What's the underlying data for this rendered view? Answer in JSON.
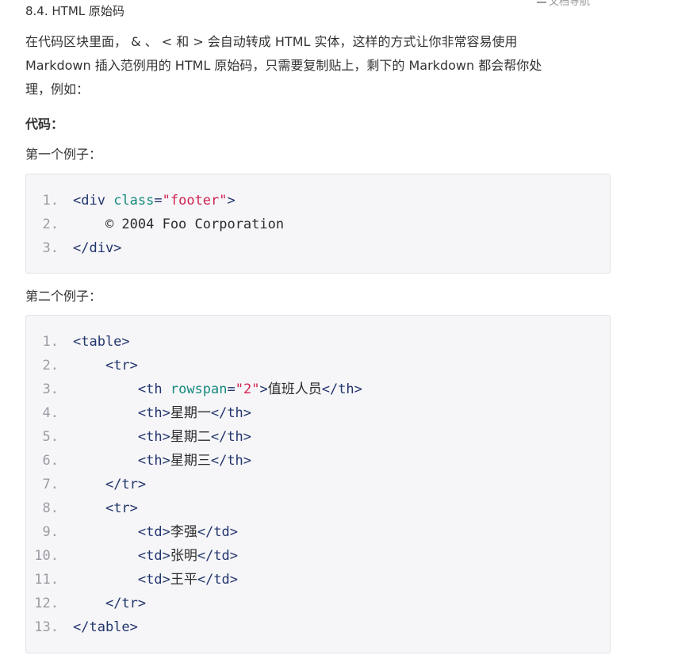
{
  "heading": "8.4. HTML 原始码",
  "corner_link": "文档导航",
  "intro_line1": "在代码区块里面， & 、 < 和 > 会自动转成 HTML 实体，这样的方式让你非常容易使用",
  "intro_line2": "Markdown 插入范例用的 HTML 原始码，只需要复制贴上，剩下的 Markdown 都会帮你处",
  "intro_line3": "理，例如：",
  "code_label": "代码：",
  "example1_label": "第一个例子：",
  "example2_label": "第二个例子：",
  "example1": {
    "line_numbers": [
      "1.",
      "2.",
      "3."
    ],
    "lines": [
      [
        {
          "t": "tag",
          "v": "<div "
        },
        {
          "t": "attr",
          "v": "class"
        },
        {
          "t": "punc",
          "v": "="
        },
        {
          "t": "str",
          "v": "\"footer\""
        },
        {
          "t": "tag",
          "v": ">"
        }
      ],
      [
        {
          "t": "txt",
          "v": "    © 2004 Foo Corporation"
        }
      ],
      [
        {
          "t": "tag",
          "v": "</div>"
        }
      ]
    ]
  },
  "example2": {
    "line_numbers": [
      "1.",
      "2.",
      "3.",
      "4.",
      "5.",
      "6.",
      "7.",
      "8.",
      "9.",
      "10.",
      "11.",
      "12.",
      "13."
    ],
    "lines": [
      [
        {
          "t": "tag",
          "v": "<table>"
        }
      ],
      [
        {
          "t": "txt",
          "v": "    "
        },
        {
          "t": "tag",
          "v": "<tr>"
        }
      ],
      [
        {
          "t": "txt",
          "v": "        "
        },
        {
          "t": "tag",
          "v": "<th "
        },
        {
          "t": "attr",
          "v": "rowspan"
        },
        {
          "t": "punc",
          "v": "="
        },
        {
          "t": "str",
          "v": "\"2\""
        },
        {
          "t": "tag",
          "v": ">"
        },
        {
          "t": "txt",
          "v": "值班人员"
        },
        {
          "t": "tag",
          "v": "</th>"
        }
      ],
      [
        {
          "t": "txt",
          "v": "        "
        },
        {
          "t": "tag",
          "v": "<th>"
        },
        {
          "t": "txt",
          "v": "星期一"
        },
        {
          "t": "tag",
          "v": "</th>"
        }
      ],
      [
        {
          "t": "txt",
          "v": "        "
        },
        {
          "t": "tag",
          "v": "<th>"
        },
        {
          "t": "txt",
          "v": "星期二"
        },
        {
          "t": "tag",
          "v": "</th>"
        }
      ],
      [
        {
          "t": "txt",
          "v": "        "
        },
        {
          "t": "tag",
          "v": "<th>"
        },
        {
          "t": "txt",
          "v": "星期三"
        },
        {
          "t": "tag",
          "v": "</th>"
        }
      ],
      [
        {
          "t": "txt",
          "v": "    "
        },
        {
          "t": "tag",
          "v": "</tr>"
        }
      ],
      [
        {
          "t": "txt",
          "v": "    "
        },
        {
          "t": "tag",
          "v": "<tr>"
        }
      ],
      [
        {
          "t": "txt",
          "v": "        "
        },
        {
          "t": "tag",
          "v": "<td>"
        },
        {
          "t": "txt",
          "v": "李强"
        },
        {
          "t": "tag",
          "v": "</td>"
        }
      ],
      [
        {
          "t": "txt",
          "v": "        "
        },
        {
          "t": "tag",
          "v": "<td>"
        },
        {
          "t": "txt",
          "v": "张明"
        },
        {
          "t": "tag",
          "v": "</td>"
        }
      ],
      [
        {
          "t": "txt",
          "v": "        "
        },
        {
          "t": "tag",
          "v": "<td>"
        },
        {
          "t": "txt",
          "v": "王平"
        },
        {
          "t": "tag",
          "v": "</td>"
        }
      ],
      [
        {
          "t": "txt",
          "v": "    "
        },
        {
          "t": "tag",
          "v": "</tr>"
        }
      ],
      [
        {
          "t": "tag",
          "v": "</table>"
        }
      ]
    ]
  },
  "colors": {
    "tag": "#22356b",
    "attr": "#178a7d",
    "string": "#d0234f",
    "line_number": "#9b9ba3",
    "code_background": "#f6f6f9"
  }
}
